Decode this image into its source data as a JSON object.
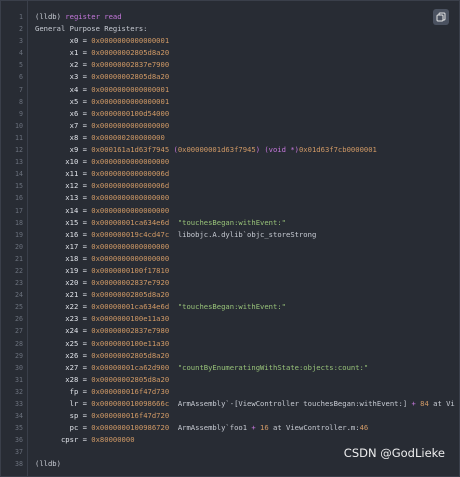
{
  "watermark": "CSDN @GodLieke",
  "icons": {
    "copy": "copy-icon"
  },
  "lines": [
    {
      "n": "1",
      "t": [
        [
          "pl",
          "(lldb) "
        ],
        [
          "kw",
          "register read"
        ]
      ]
    },
    {
      "n": "2",
      "t": [
        [
          "pl",
          "General Purpose Registers:"
        ]
      ]
    },
    {
      "n": "3",
      "t": [
        [
          "reg",
          "        x0 = "
        ],
        [
          "hex",
          "0x0000000000000001"
        ]
      ]
    },
    {
      "n": "4",
      "t": [
        [
          "reg",
          "        x1 = "
        ],
        [
          "hex",
          "0x00000002805d8a20"
        ]
      ]
    },
    {
      "n": "5",
      "t": [
        [
          "reg",
          "        x2 = "
        ],
        [
          "hex",
          "0x00000002837e7900"
        ]
      ]
    },
    {
      "n": "6",
      "t": [
        [
          "reg",
          "        x3 = "
        ],
        [
          "hex",
          "0x00000002805d8a20"
        ]
      ]
    },
    {
      "n": "7",
      "t": [
        [
          "reg",
          "        x4 = "
        ],
        [
          "hex",
          "0x0000000000000001"
        ]
      ]
    },
    {
      "n": "8",
      "t": [
        [
          "reg",
          "        x5 = "
        ],
        [
          "hex",
          "0x0000000000000001"
        ]
      ]
    },
    {
      "n": "9",
      "t": [
        [
          "reg",
          "        x6 = "
        ],
        [
          "hex",
          "0x0000000100d54000"
        ]
      ]
    },
    {
      "n": "10",
      "t": [
        [
          "reg",
          "        x7 = "
        ],
        [
          "hex",
          "0x0000000000000000"
        ]
      ]
    },
    {
      "n": "11",
      "t": [
        [
          "reg",
          "        x8 = "
        ],
        [
          "hex",
          "0x000000200000000"
        ]
      ]
    },
    {
      "n": "12",
      "t": [
        [
          "reg",
          "        x9 = "
        ],
        [
          "hex",
          "0x000161a1d63f7945 "
        ],
        [
          "kw",
          "("
        ],
        [
          "hex",
          "0x00000001d63f7945"
        ],
        [
          "kw",
          ") (void *)"
        ],
        [
          "hex",
          "0x01d63f7cb0000001"
        ]
      ]
    },
    {
      "n": "13",
      "t": [
        [
          "reg",
          "       x10 = "
        ],
        [
          "hex",
          "0x0000000000000000"
        ]
      ]
    },
    {
      "n": "14",
      "t": [
        [
          "reg",
          "       x11 = "
        ],
        [
          "hex",
          "0x000000000000006d"
        ]
      ]
    },
    {
      "n": "15",
      "t": [
        [
          "reg",
          "       x12 = "
        ],
        [
          "hex",
          "0x000000000000006d"
        ]
      ]
    },
    {
      "n": "16",
      "t": [
        [
          "reg",
          "       x13 = "
        ],
        [
          "hex",
          "0x0000000000000000"
        ]
      ]
    },
    {
      "n": "17",
      "t": [
        [
          "reg",
          "       x14 = "
        ],
        [
          "hex",
          "0x0000000000000000"
        ]
      ]
    },
    {
      "n": "18",
      "t": [
        [
          "reg",
          "       x15 = "
        ],
        [
          "hex",
          "0x00000001ca634e6d  "
        ],
        [
          "str",
          "\"touchesBegan:withEvent:\""
        ]
      ]
    },
    {
      "n": "19",
      "t": [
        [
          "reg",
          "       x16 = "
        ],
        [
          "hex",
          "0x000000019c4cd47c  "
        ],
        [
          "pl",
          "libobjc.A.dylib`objc_storeStrong"
        ]
      ]
    },
    {
      "n": "20",
      "t": [
        [
          "reg",
          "       x17 = "
        ],
        [
          "hex",
          "0x0000000000000000"
        ]
      ]
    },
    {
      "n": "21",
      "t": [
        [
          "reg",
          "       x18 = "
        ],
        [
          "hex",
          "0x0000000000000000"
        ]
      ]
    },
    {
      "n": "22",
      "t": [
        [
          "reg",
          "       x19 = "
        ],
        [
          "hex",
          "0x0000000100f17810"
        ]
      ]
    },
    {
      "n": "23",
      "t": [
        [
          "reg",
          "       x20 = "
        ],
        [
          "hex",
          "0x00000002837e7920"
        ]
      ]
    },
    {
      "n": "24",
      "t": [
        [
          "reg",
          "       x21 = "
        ],
        [
          "hex",
          "0x00000002805d8a20"
        ]
      ]
    },
    {
      "n": "25",
      "t": [
        [
          "reg",
          "       x22 = "
        ],
        [
          "hex",
          "0x00000001ca634e6d  "
        ],
        [
          "str",
          "\"touchesBegan:withEvent:\""
        ]
      ]
    },
    {
      "n": "26",
      "t": [
        [
          "reg",
          "       x23 = "
        ],
        [
          "hex",
          "0x0000000100e11a30"
        ]
      ]
    },
    {
      "n": "27",
      "t": [
        [
          "reg",
          "       x24 = "
        ],
        [
          "hex",
          "0x00000002837e7980"
        ]
      ]
    },
    {
      "n": "28",
      "t": [
        [
          "reg",
          "       x25 = "
        ],
        [
          "hex",
          "0x0000000100e11a30"
        ]
      ]
    },
    {
      "n": "29",
      "t": [
        [
          "reg",
          "       x26 = "
        ],
        [
          "hex",
          "0x00000002805d8a20"
        ]
      ]
    },
    {
      "n": "30",
      "t": [
        [
          "reg",
          "       x27 = "
        ],
        [
          "hex",
          "0x00000001ca62d900  "
        ],
        [
          "str",
          "\"countByEnumeratingWithState:objects:count:\""
        ]
      ]
    },
    {
      "n": "31",
      "t": [
        [
          "reg",
          "       x28 = "
        ],
        [
          "hex",
          "0x00000002805d8a20"
        ]
      ]
    },
    {
      "n": "32",
      "t": [
        [
          "reg",
          "        fp = "
        ],
        [
          "hex",
          "0x000000016f47d730"
        ]
      ]
    },
    {
      "n": "33",
      "t": [
        [
          "reg",
          "        lr = "
        ],
        [
          "hex",
          "0x000000010098666c  "
        ],
        [
          "pl",
          "ArmAssembly`-[ViewController touchesBegan:withEvent:] "
        ],
        [
          "kw",
          "+ "
        ],
        [
          "num",
          "84"
        ],
        [
          "pl",
          " at Vi"
        ]
      ]
    },
    {
      "n": "34",
      "t": [
        [
          "reg",
          "        sp = "
        ],
        [
          "hex",
          "0x000000016f47d720"
        ]
      ]
    },
    {
      "n": "35",
      "t": [
        [
          "reg",
          "        pc = "
        ],
        [
          "hex",
          "0x0000000100986720  "
        ],
        [
          "pl",
          "ArmAssembly`foo1 "
        ],
        [
          "kw",
          "+ "
        ],
        [
          "num",
          "16"
        ],
        [
          "pl",
          " at ViewController.m:"
        ],
        [
          "num",
          "46"
        ]
      ]
    },
    {
      "n": "36",
      "t": [
        [
          "reg",
          "      cpsr = "
        ],
        [
          "hex",
          "0x80000000"
        ]
      ]
    },
    {
      "n": "37",
      "t": [
        [
          "pl",
          ""
        ]
      ]
    },
    {
      "n": "38",
      "t": [
        [
          "pl",
          "(lldb)"
        ]
      ]
    }
  ]
}
